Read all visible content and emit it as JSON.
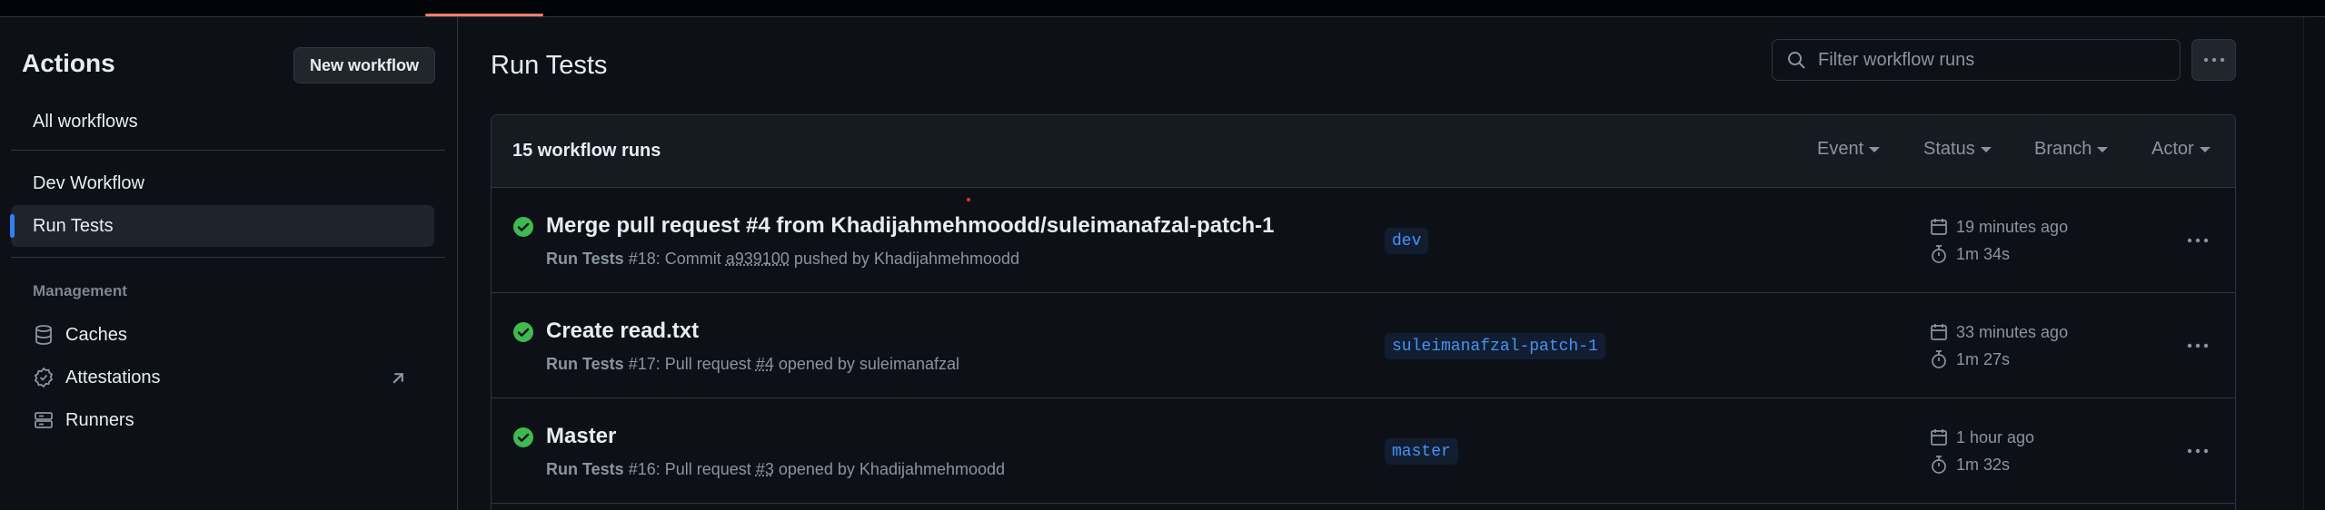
{
  "sidebar": {
    "title": "Actions",
    "new_workflow_label": "New workflow",
    "all_workflows": "All workflows",
    "workflows": [
      {
        "label": "Dev Workflow",
        "active": false
      },
      {
        "label": "Run Tests",
        "active": true
      }
    ],
    "management_label": "Management",
    "management_items": [
      {
        "label": "Caches",
        "icon": "database-icon"
      },
      {
        "label": "Attestations",
        "icon": "verified-icon",
        "external": true
      },
      {
        "label": "Runners",
        "icon": "server-icon"
      }
    ]
  },
  "main": {
    "title": "Run Tests",
    "search_placeholder": "Filter workflow runs",
    "runs_count_label": "15 workflow runs",
    "filters": [
      "Event",
      "Status",
      "Branch",
      "Actor"
    ],
    "runs": [
      {
        "title": "Merge pull request #4 from Khadijahmehmoodd/suleimanafzal-patch-1",
        "workflow": "Run Tests",
        "run_number": "#18",
        "meta_prefix": ": Commit ",
        "meta_link": "a939100",
        "meta_suffix": " pushed by Khadijahmehmoodd",
        "branch": "dev",
        "time_ago": "19 minutes ago",
        "duration": "1m 34s",
        "status": "success"
      },
      {
        "title": "Create read.txt",
        "workflow": "Run Tests",
        "run_number": "#17",
        "meta_prefix": ": Pull request ",
        "meta_link": "#4",
        "meta_suffix": " opened by suleimanafzal",
        "branch": "suleimanafzal-patch-1",
        "time_ago": "33 minutes ago",
        "duration": "1m 27s",
        "status": "success"
      },
      {
        "title": "Master",
        "workflow": "Run Tests",
        "run_number": "#16",
        "meta_prefix": ": Pull request ",
        "meta_link": "#3",
        "meta_suffix": " opened by Khadijahmehmoodd",
        "branch": "master",
        "time_ago": "1 hour ago",
        "duration": "1m 32s",
        "status": "success"
      }
    ]
  },
  "colors": {
    "background": "#0d1117",
    "success": "#3fb950",
    "accent": "#2f81f7",
    "branch_text": "#4493f8"
  }
}
